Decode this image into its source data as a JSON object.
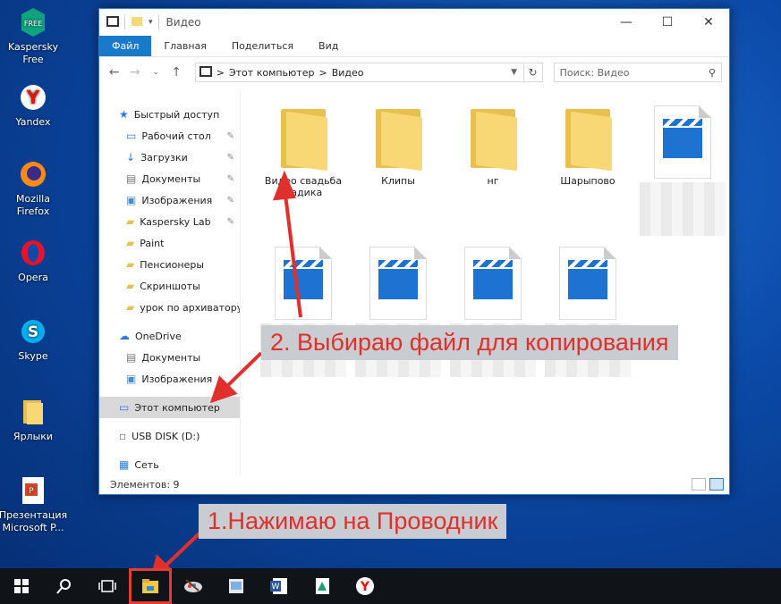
{
  "desktop_icons": [
    {
      "label": "Kaspersky\nFree",
      "icon": "kaspersky-icon"
    },
    {
      "label": "Yandex",
      "icon": "yandex-icon"
    },
    {
      "label": "Mozilla\nFirefox",
      "icon": "firefox-icon"
    },
    {
      "label": "Opera",
      "icon": "opera-icon"
    },
    {
      "label": "Skype",
      "icon": "skype-icon"
    },
    {
      "label": "Ярлыки",
      "icon": "folder-icon"
    },
    {
      "label": "Презентация\nMicrosoft P...",
      "icon": "powerpoint-icon"
    }
  ],
  "window": {
    "title": "Видео",
    "controls": {
      "minimize": "—",
      "maximize": "☐",
      "close": "✕"
    },
    "ribbon_tabs": [
      "Файл",
      "Главная",
      "Поделиться",
      "Вид"
    ],
    "address": {
      "part1": "Этот компьютер",
      "part2": "Видео",
      "sep": ">"
    },
    "search_placeholder": "Поиск: Видео",
    "nav": [
      {
        "label": "Быстрый доступ",
        "icon": "star-icon",
        "top": true
      },
      {
        "label": "Рабочий стол",
        "icon": "desktop-icon",
        "pin": true
      },
      {
        "label": "Загрузки",
        "icon": "download-icon",
        "pin": true
      },
      {
        "label": "Документы",
        "icon": "document-icon",
        "pin": true
      },
      {
        "label": "Изображения",
        "icon": "image-icon",
        "pin": true
      },
      {
        "label": "Kaspersky Lab",
        "icon": "folder-icon",
        "pin": true
      },
      {
        "label": "Paint",
        "icon": "folder-icon"
      },
      {
        "label": "Пенсионеры",
        "icon": "folder-icon"
      },
      {
        "label": "Скриншоты",
        "icon": "folder-icon"
      },
      {
        "label": "урок по архиватору",
        "icon": "folder-icon"
      },
      {
        "label": "OneDrive",
        "icon": "cloud-icon",
        "top": true
      },
      {
        "label": "Документы",
        "icon": "document-icon"
      },
      {
        "label": "Изображения",
        "icon": "image-icon"
      },
      {
        "label": "Этот компьютер",
        "icon": "computer-icon",
        "top": true,
        "selected": true
      },
      {
        "label": "USB DISK (D:)",
        "icon": "usb-icon",
        "top": true
      },
      {
        "label": "Сеть",
        "icon": "network-icon",
        "top": true
      }
    ],
    "files": [
      {
        "name": "Видео свадьба\nВадика",
        "type": "folder"
      },
      {
        "name": "Клипы",
        "type": "folder"
      },
      {
        "name": "нг",
        "type": "folder"
      },
      {
        "name": "Шарыпово",
        "type": "folder"
      },
      {
        "name": "",
        "type": "video"
      },
      {
        "name": "",
        "type": "video"
      },
      {
        "name": "",
        "type": "video"
      },
      {
        "name": "",
        "type": "video"
      },
      {
        "name": "",
        "type": "video"
      }
    ],
    "status": "Элементов: 9"
  },
  "annotations": {
    "step1": "1.Нажимаю на Проводник",
    "step2": "2. Выбираю файл для копирования"
  },
  "colors": {
    "accent": "#1979ca",
    "annotation": "#e0302b"
  }
}
